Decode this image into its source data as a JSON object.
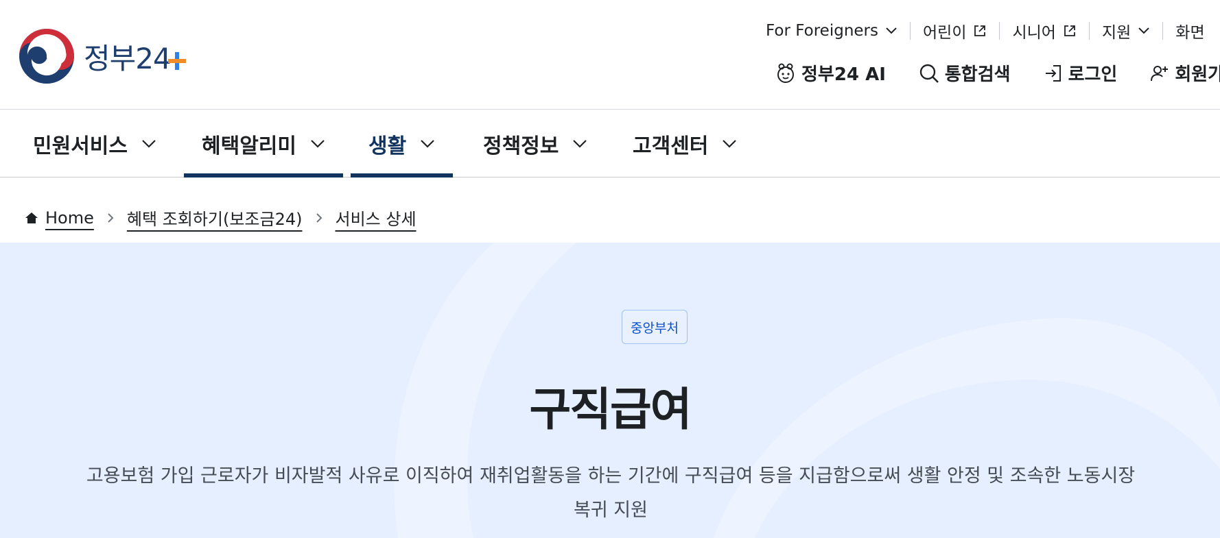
{
  "header": {
    "logo_text": "정부24",
    "utility_nav": [
      {
        "label": "For Foreigners",
        "icon": "chevron-down-icon"
      },
      {
        "label": "어린이",
        "icon": "external-link-icon"
      },
      {
        "label": "시니어",
        "icon": "external-link-icon"
      },
      {
        "label": "지원",
        "icon": "chevron-down-icon"
      },
      {
        "label": "화면",
        "icon": ""
      }
    ],
    "quick_nav": [
      {
        "label": "정부24 AI",
        "icon": "ai-mascot-icon"
      },
      {
        "label": "통합검색",
        "icon": "search-icon"
      },
      {
        "label": "로그인",
        "icon": "login-icon"
      },
      {
        "label": "회원가입",
        "icon": "user-plus-icon"
      }
    ]
  },
  "gnb": {
    "items": [
      {
        "label": "민원서비스",
        "active": false
      },
      {
        "label": "혜택알리미",
        "active": true
      },
      {
        "label": "생활",
        "active": true
      },
      {
        "label": "정책정보",
        "active": false
      },
      {
        "label": "고객센터",
        "active": false
      }
    ]
  },
  "breadcrumb": {
    "items": [
      "Home",
      "혜택 조회하기(보조금24)",
      "서비스 상세"
    ]
  },
  "hero": {
    "badge": "중앙부처",
    "title": "구직급여",
    "description": "고용보험 가입 근로자가 비자발적 사유로 이직하여 재취업활동을 하는 기간에 구직급여 등을 지급함으로써 생활 안정 및 조속한 노동시장 복귀 지원"
  },
  "colors": {
    "navy": "#10335f",
    "hero_bg": "#e6efff",
    "badge_text": "#0b50d0",
    "logo_red": "#cd2e3a",
    "logo_blue": "#1d3e6e",
    "plus_orange": "#f28c28",
    "plus_blue": "#2f80ed"
  }
}
